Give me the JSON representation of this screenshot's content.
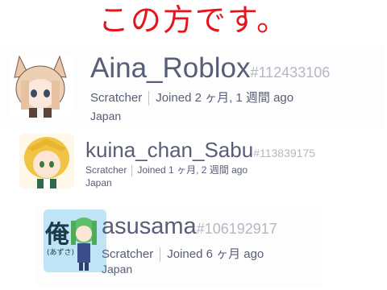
{
  "headline": "この方です。",
  "users": [
    {
      "username": "Aina_Roblox",
      "user_id": "#112433106",
      "role": "Scratcher",
      "joined": "Joined 2 ヶ月, 1 週間 ago",
      "country": "Japan",
      "avatar_icon": "chibi-girl-fox-ears-avatar"
    },
    {
      "username": "kuina_chan_Sabu",
      "user_id": "#113839175",
      "role": "Scratcher",
      "joined": "Joined 1 ヶ月, 2 週間 ago",
      "country": "Japan",
      "avatar_icon": "anime-blonde-girl-avatar"
    },
    {
      "username": "asusama",
      "user_id": "#106192917",
      "role": "Scratcher",
      "joined": "Joined 6 ヶ月 ago",
      "country": "Japan",
      "avatar_icon": "green-hair-kanji-avatar",
      "avatar_kanji": "俺",
      "avatar_caption": "(あずさ)"
    }
  ],
  "colors": {
    "headline": "#e8141b",
    "text": "#575e75",
    "user_id": "#b4b8c3"
  }
}
